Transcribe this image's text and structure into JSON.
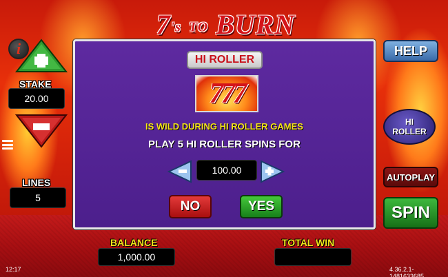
{
  "game": {
    "logo_main": "7",
    "logo_s": "'s",
    "logo_to": "TO",
    "logo_burn": "BURN"
  },
  "left": {
    "info_label": "i",
    "stake_label": "STAKE",
    "stake_value": "20.00",
    "lines_label": "LINES",
    "lines_value": "5"
  },
  "right": {
    "help_label": "HELP",
    "hiroller_line1": "HI",
    "hiroller_line2": "ROLLER",
    "autoplay_label": "AUTOPLAY",
    "spin_label": "SPIN"
  },
  "dialog": {
    "title": "HI ROLLER",
    "symbol_text": "777",
    "wild_text": "IS WILD DURING HI ROLLER GAMES",
    "play_text": "PLAY 5 HI ROLLER SPINS FOR",
    "amount": "100.00",
    "minus_label": "−",
    "plus_label": "+",
    "no_label": "NO",
    "yes_label": "YES"
  },
  "bottom": {
    "balance_label": "BALANCE",
    "balance_value": "1,000.00",
    "totalwin_label": "TOTAL WIN",
    "totalwin_value": "",
    "clock": "12:17",
    "version": "4.36.2.1-1481633685"
  },
  "colors": {
    "accent_yellow": "#f3e21a",
    "dialog_bg": "#5e2aa0",
    "spin_green": "#3db83d",
    "no_red": "#e43a3a"
  }
}
